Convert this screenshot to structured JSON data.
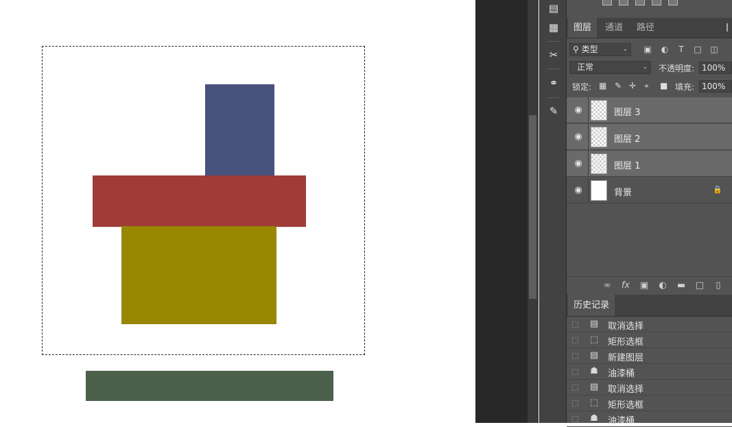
{
  "layers_panel": {
    "tabs": [
      {
        "label": "图层"
      },
      {
        "label": "通道"
      },
      {
        "label": "路径"
      }
    ],
    "filter": {
      "label": "类型",
      "prefix_icon": "search-icon"
    },
    "filter_icons": [
      "image-icon",
      "adjustment-icon",
      "type-icon",
      "shape-icon",
      "smart-object-icon"
    ],
    "blend_mode": "正常",
    "opacity_label": "不透明度:",
    "opacity_value": "100%",
    "lock_label": "锁定:",
    "lock_icons": [
      "lock-transparent-icon",
      "lock-paint-icon",
      "lock-move-icon",
      "lock-artboard-icon",
      "lock-all-icon"
    ],
    "fill_label": "填充:",
    "fill_value": "100%",
    "layers": [
      {
        "name": "图层 3",
        "selected": true
      },
      {
        "name": "图层 2",
        "selected": true
      },
      {
        "name": "图层 1",
        "selected": true
      },
      {
        "name": "背景",
        "selected": false,
        "locked": true
      }
    ],
    "footer_icons": [
      "link-icon",
      "fx-icon",
      "mask-icon",
      "adjustment-layer-icon",
      "folder-icon",
      "new-layer-icon",
      "trash-icon"
    ]
  },
  "history_panel": {
    "tab_label": "历史记录",
    "items": [
      {
        "label": "取消选择",
        "icon": "document-icon"
      },
      {
        "label": "矩形选框",
        "icon": "marquee-icon"
      },
      {
        "label": "新建图层",
        "icon": "document-icon"
      },
      {
        "label": "油漆桶",
        "icon": "paint-bucket-icon"
      },
      {
        "label": "取消选择",
        "icon": "document-icon"
      },
      {
        "label": "矩形选框",
        "icon": "marquee-icon"
      },
      {
        "label": "油漆桶",
        "icon": "paint-bucket-icon"
      }
    ]
  },
  "canvas": {
    "colors": {
      "blue": "#47527d",
      "red": "#9f3c38",
      "olive": "#978701",
      "green": "#4c614c"
    }
  }
}
